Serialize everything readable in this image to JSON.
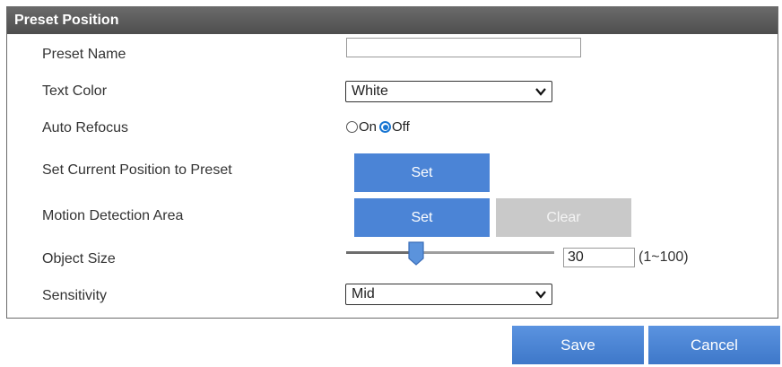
{
  "panel": {
    "title": "Preset Position"
  },
  "rows": {
    "preset_name": {
      "label": "Preset Name",
      "value": ""
    },
    "text_color": {
      "label": "Text Color",
      "selected": "White"
    },
    "auto_refocus": {
      "label": "Auto Refocus",
      "on_label": "On",
      "off_label": "Off",
      "selected": "Off"
    },
    "set_current": {
      "label": "Set Current Position to Preset",
      "set_label": "Set"
    },
    "motion_area": {
      "label": "Motion Detection Area",
      "set_label": "Set",
      "clear_label": "Clear"
    },
    "object_size": {
      "label": "Object Size",
      "value": "30",
      "range": "(1~100)",
      "min": 1,
      "max": 100,
      "level": 30
    },
    "sensitivity": {
      "label": "Sensitivity",
      "selected": "Mid"
    }
  },
  "footer": {
    "save_label": "Save",
    "cancel_label": "Cancel"
  },
  "colors": {
    "accent": "#4b84d6",
    "header_bg": "#5c5c5c",
    "disabled": "#c9c9c9"
  },
  "icons": {
    "dropdown": "chevron-down-icon",
    "slider": "slider-thumb-icon"
  }
}
